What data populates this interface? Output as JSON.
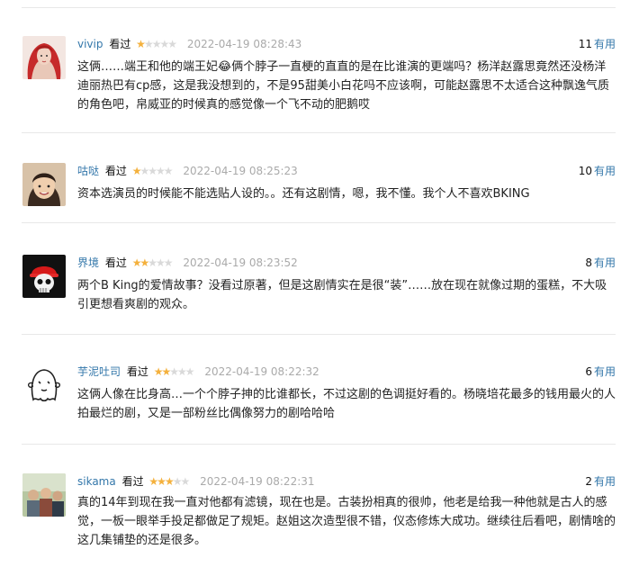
{
  "colors": {
    "link": "#3377aa",
    "star_on": "#f4b13d",
    "star_off": "#d9d9d9",
    "time": "#aaaaaa",
    "divider": "#e8e8e8"
  },
  "comments": [
    {
      "user": "vivip",
      "status": "看过",
      "rating": 1,
      "time": "2022-04-19 08:28:43",
      "votes": "11",
      "votes_label": "有用",
      "avatar": "avatar-photo-red-hair",
      "text": "这俩……端王和他的端王妃😂俩个脖子一直梗的直直的是在比谁演的更端吗？杨洋赵露思竟然还没杨洋迪丽热巴有cp感，这是我没想到的，不是95甜美小白花吗不应该啊，可能赵露思不太适合这种飘逸气质的角色吧，帛威亚的时候真的感觉像一个飞不动的肥鹅哎"
    },
    {
      "user": "咕哒",
      "status": "看过",
      "rating": 1,
      "time": "2022-04-19 08:25:23",
      "votes": "10",
      "votes_label": "有用",
      "avatar": "avatar-photo-child",
      "text": "资本选演员的时候能不能选贴人设的。。还有这剧情，嗯，我不懂。我个人不喜欢BKING"
    },
    {
      "user": "界境",
      "status": "看过",
      "rating": 2,
      "time": "2022-04-19 08:23:52",
      "votes": "8",
      "votes_label": "有用",
      "avatar": "avatar-skull-red",
      "text": "两个B King的爱情故事？没看过原著，但是这剧情实在是很“装”……放在现在就像过期的蛋糕，不大吸引更想看爽剧的观众。"
    },
    {
      "user": "芋泥吐司",
      "status": "看过",
      "rating": 2,
      "time": "2022-04-19 08:22:32",
      "votes": "6",
      "votes_label": "有用",
      "avatar": "avatar-doodle-ghost",
      "text": "这俩人像在比身高…一个个脖子抻的比谁都长，不过这剧的色调挺好看的。杨晓培花最多的钱用最火的人拍最烂的剧，又是一部粉丝比偶像努力的剧哈哈哈"
    },
    {
      "user": "sikama",
      "status": "看过",
      "rating": 3,
      "time": "2022-04-19 08:22:31",
      "votes": "2",
      "votes_label": "有用",
      "avatar": "avatar-photo-group",
      "text": "真的14年到现在我一直对他都有滤镜，现在也是。古装扮相真的很帅，他老是给我一种他就是古人的感觉，一板一眼举手投足都做足了规矩。赵姐这次造型很不错，仪态修炼大成功。继续往后看吧，剧情啥的这几集铺垫的还是很多。"
    }
  ]
}
